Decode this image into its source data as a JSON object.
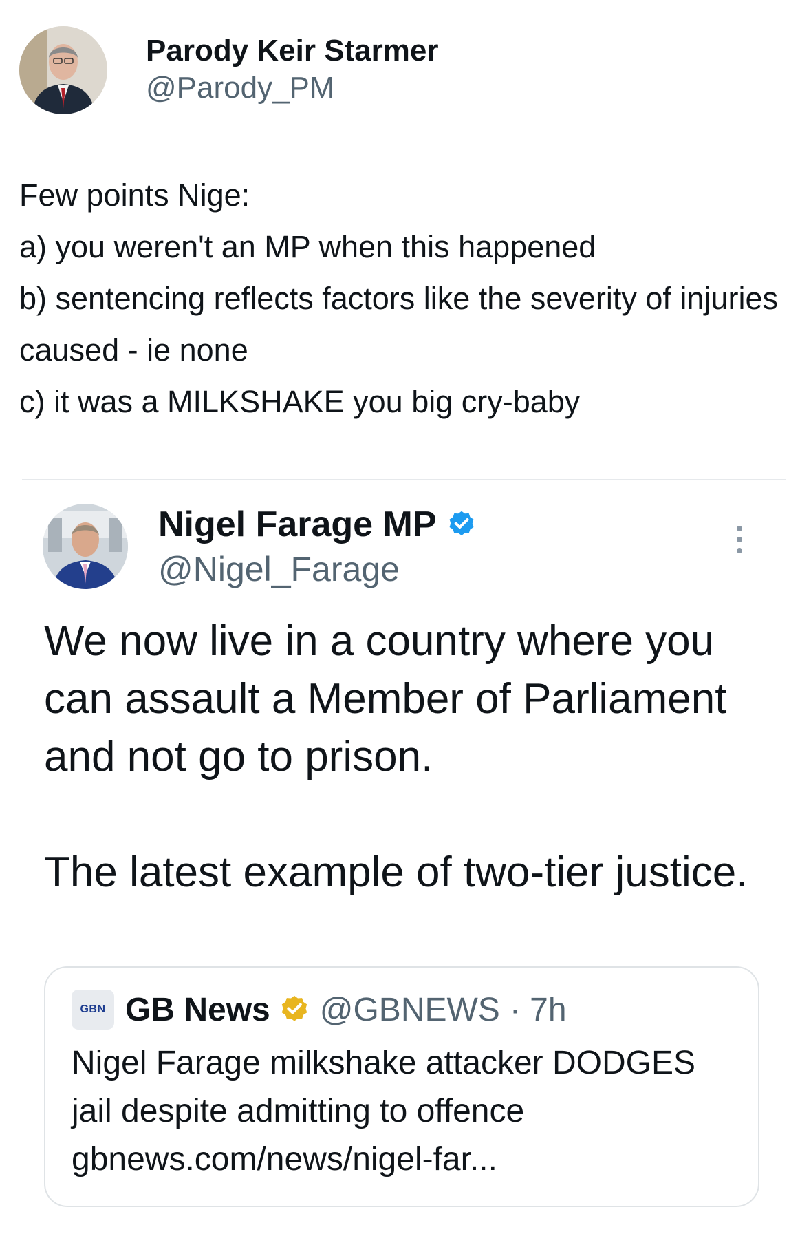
{
  "tweet": {
    "author": {
      "display_name": "Parody Keir Starmer",
      "handle": "@Parody_PM",
      "avatar_icon": "profile-photo"
    },
    "text": "Few points Nige:\na) you weren't an MP when this happened\nb) sentencing reflects factors like the severity of injuries caused - ie none\nc) it was a MILKSHAKE you big cry-baby"
  },
  "embedded_tweet": {
    "author": {
      "display_name": "Nigel Farage MP",
      "handle": "@Nigel_Farage",
      "verified": true,
      "verified_color": "#1d9bf0",
      "avatar_icon": "profile-photo"
    },
    "text": "We now live in a country where you can assault a Member of Parliament and not go to prison.\n\nThe latest example of two-tier justice.",
    "menu_icon": "more-vertical-icon"
  },
  "quoted_tweet": {
    "logo_text": "GBN",
    "display_name": "GB News",
    "handle": "@GBNEWS",
    "time": "· 7h",
    "verified": true,
    "verified_color": "#e8b520",
    "text": "Nigel Farage milkshake attacker DODGES jail despite admitting to offence gbnews.com/news/nigel-far..."
  }
}
